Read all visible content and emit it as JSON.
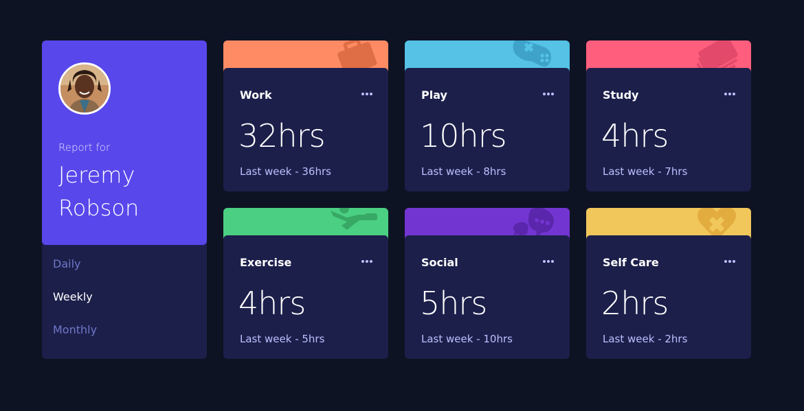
{
  "profile": {
    "report_label": "Report for",
    "name": "Jeremy Robson"
  },
  "timeframes": {
    "daily": "Daily",
    "weekly": "Weekly",
    "monthly": "Monthly",
    "selected": "Weekly"
  },
  "activities": [
    {
      "title": "Work",
      "current": "32hrs",
      "previous": "Last week - 36hrs",
      "color": "#ff8b64",
      "icon": "briefcase-icon"
    },
    {
      "title": "Play",
      "current": "10hrs",
      "previous": "Last week - 8hrs",
      "color": "#55c2e6",
      "icon": "gamepad-icon"
    },
    {
      "title": "Study",
      "current": "4hrs",
      "previous": "Last week - 7hrs",
      "color": "#ff5e7d",
      "icon": "book-icon"
    },
    {
      "title": "Exercise",
      "current": "4hrs",
      "previous": "Last week - 5hrs",
      "color": "#4bcf82",
      "icon": "running-icon"
    },
    {
      "title": "Social",
      "current": "5hrs",
      "previous": "Last week - 10hrs",
      "color": "#7335d2",
      "icon": "chat-icon"
    },
    {
      "title": "Self Care",
      "current": "2hrs",
      "previous": "Last week - 2hrs",
      "color": "#f1c75b",
      "icon": "heart-icon"
    }
  ],
  "colors": {
    "background": "#0e1323",
    "card": "#1c1f4a",
    "accent": "#5847eb",
    "muted_text": "#bbc0ff"
  }
}
